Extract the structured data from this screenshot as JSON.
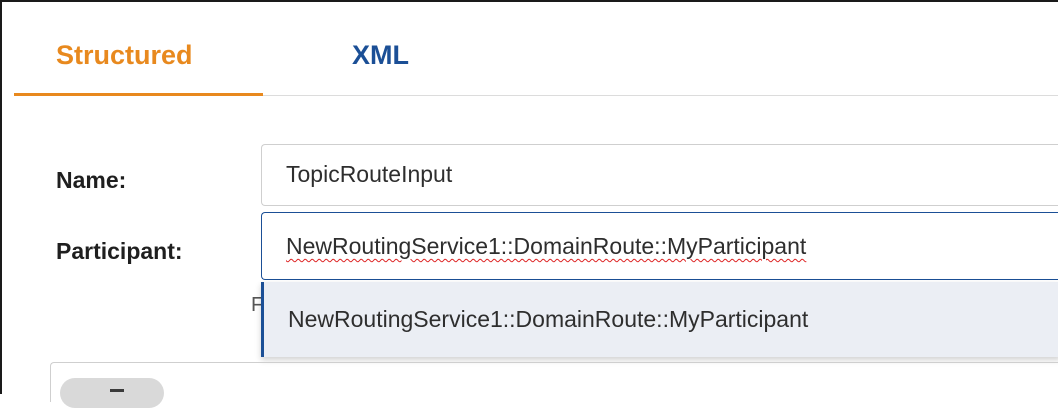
{
  "tabs": {
    "structured": "Structured",
    "xml": "XML"
  },
  "form": {
    "name_label": "Name:",
    "name_value": "TopicRouteInput",
    "participant_label": "Participant:",
    "participant_value": "NewRoutingService1::DomainRoute::MyParticipant",
    "helper_prefix": "F"
  },
  "dropdown": {
    "options": [
      "NewRoutingService1::DomainRoute::MyParticipant"
    ]
  },
  "colors": {
    "accent": "#e8891e",
    "primary": "#1b4f96",
    "dropdown_bg": "#ebeef4"
  }
}
